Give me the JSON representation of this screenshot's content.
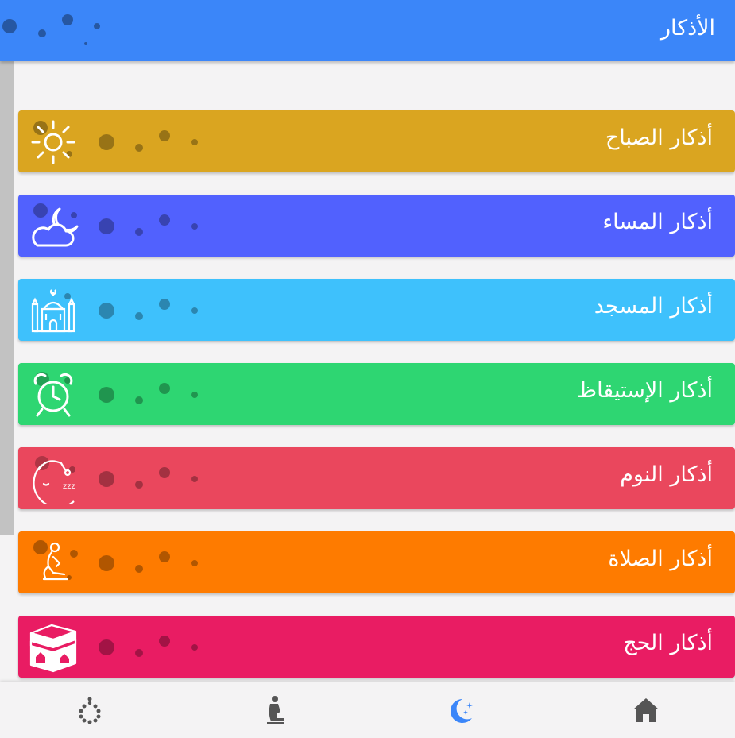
{
  "appbar": {
    "title": "الأذكار",
    "color": "#3b86f9"
  },
  "cards": [
    {
      "label": "أذكار الصباح",
      "color": "#daa520",
      "icon": "sun-icon"
    },
    {
      "label": "أذكار المساء",
      "color": "#5161fe",
      "icon": "moon-cloud-icon"
    },
    {
      "label": "أذكار المسجد",
      "color": "#3ec1fc",
      "icon": "mosque-icon"
    },
    {
      "label": "أذكار الإستيقاظ",
      "color": "#2ed672",
      "icon": "alarm-clock-icon"
    },
    {
      "label": "أذكار النوم",
      "color": "#ea475d",
      "icon": "sleeping-moon-icon"
    },
    {
      "label": "أذكار الصلاة",
      "color": "#fe7b00",
      "icon": "praying-person-icon"
    },
    {
      "label": "أذكار الحج",
      "color": "#e91c63",
      "icon": "kaaba-icon"
    }
  ],
  "bottom_nav": [
    {
      "icon": "prayer-beads-icon",
      "active": false
    },
    {
      "icon": "praying-person-icon",
      "active": false
    },
    {
      "icon": "crescent-moon-icon",
      "active": true
    },
    {
      "icon": "home-icon",
      "active": false
    }
  ],
  "colors": {
    "background": "#f4f3f4",
    "nav_icon": "#555555",
    "nav_active": "#3b86f9"
  }
}
